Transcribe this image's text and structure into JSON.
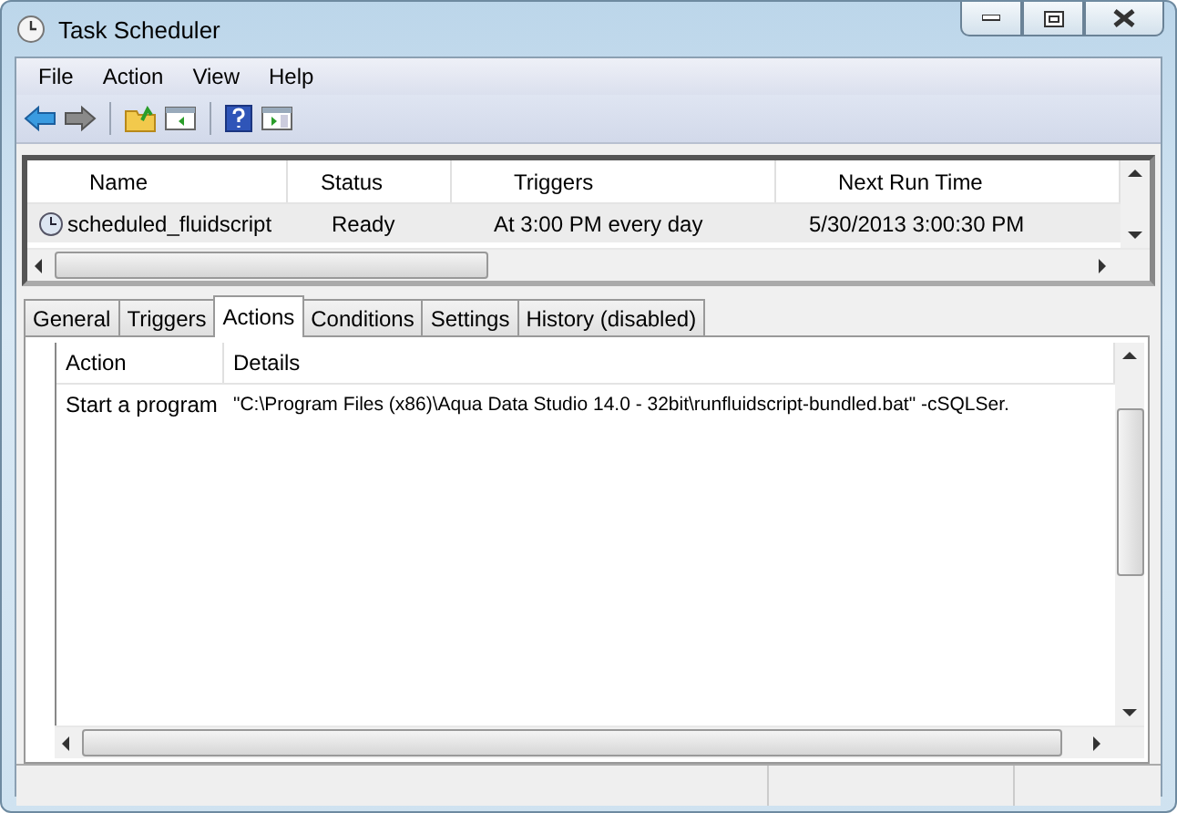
{
  "window": {
    "title": "Task Scheduler"
  },
  "menu": [
    "File",
    "Action",
    "View",
    "Help"
  ],
  "task_list": {
    "columns": [
      "Name",
      "Status",
      "Triggers",
      "Next Run Time"
    ],
    "rows": [
      {
        "cells": [
          "scheduled_fluidscript",
          "Ready",
          "At 3:00 PM every day",
          "5/30/2013 3:00:30 PM"
        ],
        "selected": true
      }
    ]
  },
  "tabs": [
    {
      "label": "General",
      "selected": false
    },
    {
      "label": "Triggers",
      "selected": false
    },
    {
      "label": "Actions",
      "selected": true
    },
    {
      "label": "Conditions",
      "selected": false
    },
    {
      "label": "Settings",
      "selected": false
    },
    {
      "label": "History (disabled)",
      "selected": false
    }
  ],
  "actions_table": {
    "columns": [
      "Action",
      "Details"
    ],
    "rows": [
      {
        "cells": [
          "Start a program",
          "\"C:\\Program Files (x86)\\Aqua Data Studio 14.0 - 32bit\\runfluidscript-bundled.bat\" -cSQLSer."
        ]
      }
    ]
  }
}
